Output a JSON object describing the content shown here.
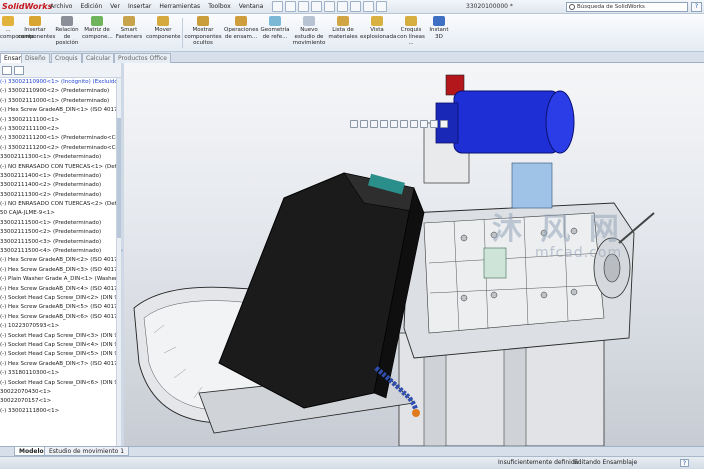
{
  "app": {
    "logo_text": "SolidWorks",
    "document_title": "33020100000 *",
    "search_placeholder": "Búsqueda de SolidWorks"
  },
  "menu": [
    "Archivo",
    "Edición",
    "Ver",
    "Insertar",
    "Herramientas",
    "Toolbox",
    "Ventana",
    "?"
  ],
  "commands": [
    {
      "label1": "...",
      "label2": "componente",
      "icon": "insert-component-icon"
    },
    {
      "label1": "Insertar",
      "label2": "componentes",
      "icon": "insert-components-icon"
    },
    {
      "label1": "Relación",
      "label2": "de posición",
      "icon": "mate-icon"
    },
    {
      "label1": "Matriz de",
      "label2": "compone...",
      "icon": "component-pattern-icon"
    },
    {
      "label1": "Smart",
      "label2": "Fasteners",
      "icon": "smart-fasteners-icon"
    },
    {
      "label1": "Mover",
      "label2": "componente",
      "icon": "move-component-icon"
    },
    {
      "label1": "Mostrar",
      "label2": "componentes ocultos",
      "icon": "show-hidden-icon"
    },
    {
      "label1": "Operaciones",
      "label2": "de ensam...",
      "icon": "assembly-features-icon"
    },
    {
      "label1": "Geometría",
      "label2": "de refe...",
      "icon": "reference-geometry-icon"
    },
    {
      "label1": "Nuevo",
      "label2": "estudio de movimiento",
      "icon": "motion-study-icon"
    },
    {
      "label1": "Lista de",
      "label2": "materiales",
      "icon": "bom-icon"
    },
    {
      "label1": "Vista",
      "label2": "explosionada",
      "icon": "exploded-view-icon"
    },
    {
      "label1": "Croquis",
      "label2": "con líneas ...",
      "icon": "explode-line-sketch-icon"
    },
    {
      "label1": "Instant",
      "label2": "3D",
      "icon": "instant3d-icon"
    }
  ],
  "tabs": [
    "Ensamblaje",
    "Diseño",
    "Croquis",
    "Calcular",
    "Productos Office"
  ],
  "active_tab": "Ensamblaje",
  "tree_items": [
    "(-) 33002110900<1> (Incógnito) (Excluido de",
    "(-) 33002110900<2> (Predeterminado)",
    "(-) 33002111000<1> (Predeterminado)",
    "(-) Hex Screw GradeAB_DIN<1> (ISO 4017 -",
    "(-) 33002111100<1>",
    "(-) 33002111100<2>",
    "(-) 33002111200<1> (Predeterminado<Conv",
    "(-) 33002111200<2> (Predeterminado<Conv",
    "33002111300<1> (Predeterminado)",
    "(-) NO ENRASADO CON TUERCAS<1> (Defa...",
    "33002111400<1> (Predeterminado)",
    "33002111400<2> (Predeterminado)",
    "33002111300<2> (Predeterminado)",
    "(-) NO ENRASADO CON TUERCAS<2> (Defa...",
    "50 CAJA-JLME-9<1>",
    "33002111500<1> (Predeterminado)",
    "33002111500<2> (Predeterminado)",
    "33002111500<3> (Predeterminado)",
    "33002111500<4> (Predeterminado)",
    "(-) Hex Screw GradeAB_DIN<2> (ISO 4017 -",
    "(-) Hex Screw GradeAB_DIN<3> (ISO 4017 -",
    "(-) Plain Washer Grade A_DIN<1> (Washer D",
    "(-) Hex Screw GradeAB_DIN<4> (ISO 4017 -",
    "(-) Socket Head Cap Screw_DIN<2> (DIN 912",
    "(-) Hex Screw GradeAB_DIN<5> (ISO 4017 -",
    "(-) Hex Screw GradeAB_DIN<6> (ISO 4017 -",
    "(-) 10223070593<1>",
    "(-) Socket Head Cap Screw_DIN<3> (DIN 912",
    "(-) Socket Head Cap Screw_DIN<4> (DIN 912",
    "(-) Socket Head Cap Screw_DIN<5> (DIN 912",
    "(-) Hex Screw GradeAB_DIN<7> (ISO 4017 -",
    "(-) 33180110300<1>",
    "(-) Socket Head Cap Screw_DIN<6> (DIN 912",
    "30022070430<1>",
    "30022070157<1>",
    "(-) 33002111800<1>"
  ],
  "bottom_tabs": [
    "Modelo",
    "Estudio de movimiento 1"
  ],
  "status": {
    "definition": "Insuficientemente definida",
    "mode": "Editando Ensamblaje",
    "help": "?"
  },
  "watermark": {
    "text": "沐 风 网",
    "url": "mfcad.com"
  },
  "colors": {
    "motor_blue": "#1f2fd6",
    "panel_black": "#1b1b1b",
    "accent_red": "#c4161c",
    "highlight_blue": "#1b3fd0"
  }
}
